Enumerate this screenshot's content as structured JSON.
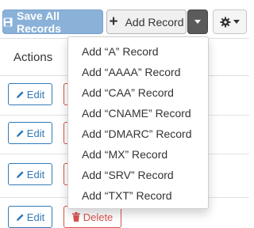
{
  "toolbar": {
    "save_label": "Save All Records",
    "add_label": "Add Record",
    "plus_glyph": "+"
  },
  "table": {
    "header_actions": "Actions",
    "edit_label": "Edit",
    "delete_label": "Delete"
  },
  "add_record_menu": {
    "items": [
      "Add “A” Record",
      "Add “AAAA” Record",
      "Add “CAA” Record",
      "Add “CNAME” Record",
      "Add “DMARC” Record",
      "Add “MX” Record",
      "Add “SRV” Record",
      "Add “TXT” Record"
    ]
  },
  "icons": {
    "save": "floppy-disk-icon",
    "add": "plus-icon",
    "caret": "caret-down-icon",
    "settings": "gear-icon",
    "edit": "pencil-icon",
    "delete": "trash-icon"
  },
  "colors": {
    "primary_disabled": "#8ab1d8",
    "primary": "#337ab7",
    "danger": "#d9534f",
    "dark_caret": "#5b5b5b"
  }
}
